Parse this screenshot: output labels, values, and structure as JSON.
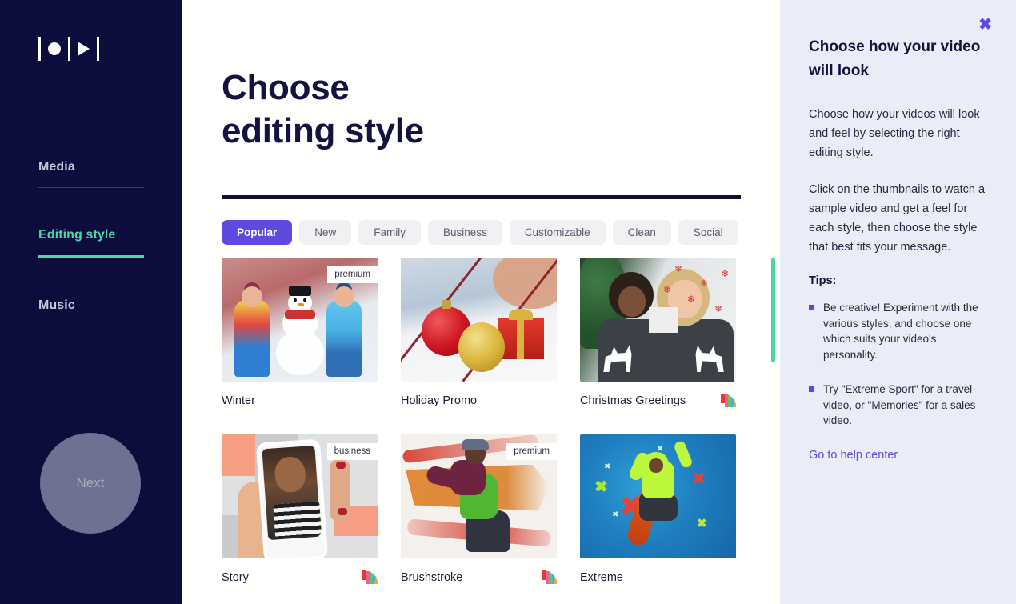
{
  "sidebar": {
    "logo_name": "video-editor-logo",
    "items": [
      {
        "label": "Media",
        "active": false
      },
      {
        "label": "Editing style",
        "active": true
      },
      {
        "label": "Music",
        "active": false
      }
    ],
    "next_button": "Next"
  },
  "main": {
    "title_line1": "Choose",
    "title_line2": "editing style",
    "tabs": [
      {
        "label": "Popular",
        "active": true
      },
      {
        "label": "New",
        "active": false
      },
      {
        "label": "Family",
        "active": false
      },
      {
        "label": "Business",
        "active": false
      },
      {
        "label": "Customizable",
        "active": false
      },
      {
        "label": "Clean",
        "active": false
      },
      {
        "label": "Social",
        "active": false
      }
    ],
    "tabs_next_icon": "chevron-right-icon",
    "styles": [
      {
        "title": "Winter",
        "badge": "premium",
        "has_palette": false
      },
      {
        "title": "Holiday Promo",
        "badge": "",
        "has_palette": false
      },
      {
        "title": "Christmas Greetings",
        "badge": "",
        "has_palette": true
      },
      {
        "title": "Story",
        "badge": "business",
        "has_palette": true
      },
      {
        "title": "Brushstroke",
        "badge": "premium",
        "has_palette": true
      },
      {
        "title": "Extreme",
        "badge": "",
        "has_palette": false
      }
    ]
  },
  "help_panel": {
    "close_icon": "close-icon",
    "title": "Choose how your video will look",
    "paragraphs": [
      "Choose how your videos will look and feel by selecting the right editing style.",
      "Click on the thumbnails to watch a sample video and get a feel for each style, then choose the style that best fits your message."
    ],
    "tips_label": "Tips:",
    "tips": [
      "Be creative! Experiment with the various styles, and choose one which suits your video's personality.",
      "Try \"Extreme Sport\" for a travel video, or \"Memories\" for a sales video."
    ],
    "link": "Go to help center"
  },
  "colors": {
    "sidebar_bg": "#0d0d3d",
    "accent_green": "#4fd5aa",
    "accent_purple": "#5f4ae0",
    "panel_bg": "#eaedf7",
    "title_navy": "#131240"
  }
}
